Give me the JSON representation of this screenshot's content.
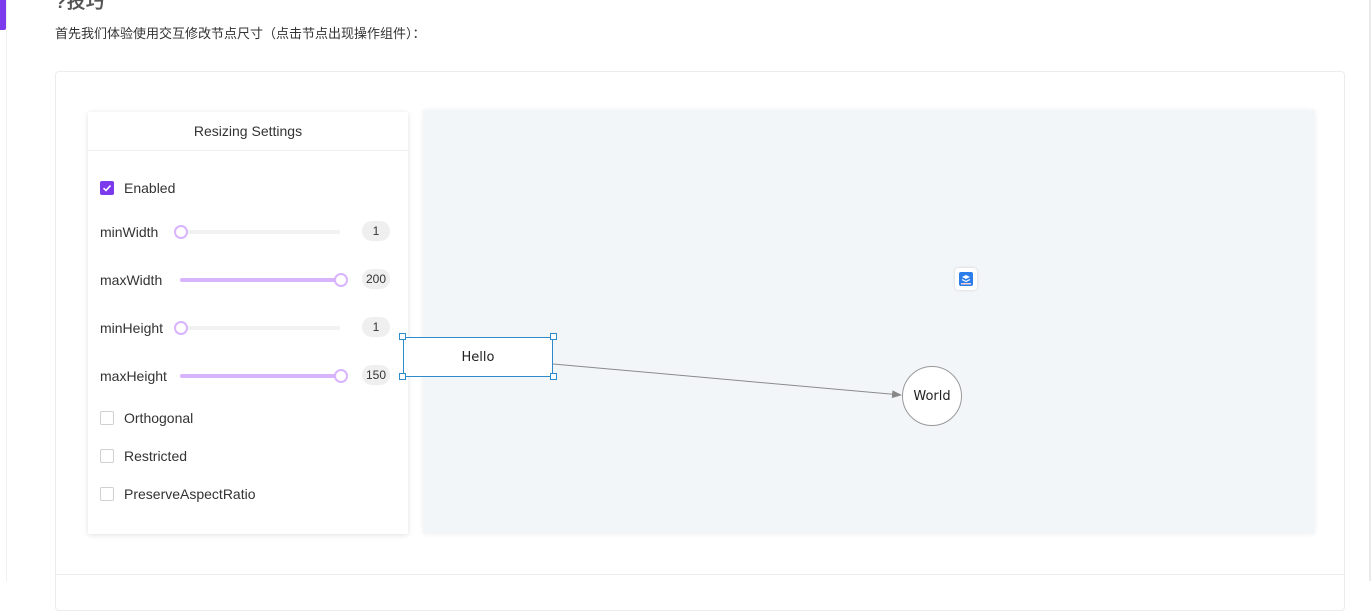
{
  "page": {
    "heading_fragment": "?技巧",
    "intro_text": "首先我们体验使用交互修改节点尺寸（点击节点出现操作组件）："
  },
  "settings": {
    "title": "Resizing Settings",
    "enabled": {
      "label": "Enabled",
      "checked": true
    },
    "sliders": [
      {
        "label": "minWidth",
        "value": "1",
        "fraction": 0.0
      },
      {
        "label": "maxWidth",
        "value": "200",
        "fraction": 1.0
      },
      {
        "label": "minHeight",
        "value": "1",
        "fraction": 0.0
      },
      {
        "label": "maxHeight",
        "value": "150",
        "fraction": 1.0
      }
    ],
    "options": [
      {
        "label": "Orthogonal",
        "checked": false
      },
      {
        "label": "Restricted",
        "checked": false
      },
      {
        "label": "PreserveAspectRatio",
        "checked": false
      }
    ]
  },
  "graph": {
    "node_hello": "Hello",
    "node_world": "World"
  },
  "colors": {
    "accent": "#7c3aed",
    "slider": "#d8b4fe",
    "selection": "#2c8bc8",
    "canvas_bg": "#f3f6f9"
  }
}
